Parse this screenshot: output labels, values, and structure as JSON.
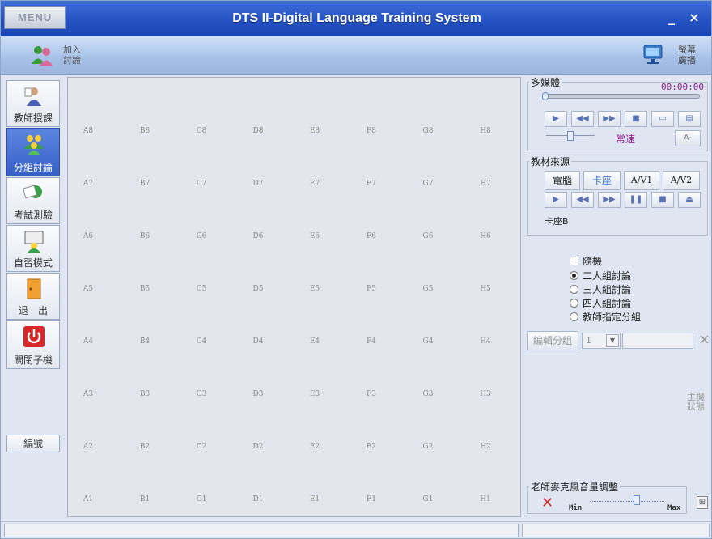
{
  "window": {
    "menu_label": "MENU",
    "title": "DTS II-Digital Language Training System",
    "minimize": "_",
    "close": "×"
  },
  "toolbar": {
    "join_label": "加入\n討論",
    "broadcast_label": "螢幕\n廣播"
  },
  "sidebar": {
    "items": [
      {
        "label": "教師授課",
        "icon": "teacher-icon"
      },
      {
        "label": "分組討論",
        "icon": "group-icon",
        "active": true
      },
      {
        "label": "考試測驗",
        "icon": "exam-icon"
      },
      {
        "label": "自習模式",
        "icon": "study-icon"
      },
      {
        "label": "退　出",
        "icon": "exit-door-icon"
      },
      {
        "label": "關閉子機",
        "icon": "power-icon"
      }
    ],
    "edit_label": "編號"
  },
  "grid": {
    "rows": [
      [
        "A8",
        "B8",
        "C8",
        "D8",
        "E8",
        "F8",
        "G8",
        "H8"
      ],
      [
        "A7",
        "B7",
        "C7",
        "D7",
        "E7",
        "F7",
        "G7",
        "H7"
      ],
      [
        "A6",
        "B6",
        "C6",
        "D6",
        "E6",
        "F6",
        "G6",
        "H6"
      ],
      [
        "A5",
        "B5",
        "C5",
        "D5",
        "E5",
        "F5",
        "G5",
        "H5"
      ],
      [
        "A4",
        "B4",
        "C4",
        "D4",
        "E4",
        "F4",
        "G4",
        "H4"
      ],
      [
        "A3",
        "B3",
        "C3",
        "D3",
        "E3",
        "F3",
        "G3",
        "H3"
      ],
      [
        "A2",
        "B2",
        "C2",
        "D2",
        "E2",
        "F2",
        "G2",
        "H2"
      ],
      [
        "A1",
        "B1",
        "C1",
        "D1",
        "E1",
        "F1",
        "G1",
        "H1"
      ]
    ]
  },
  "multimedia": {
    "legend": "多媒體",
    "time": "00:00:00",
    "speed_label": "常速",
    "font_btn": "A-"
  },
  "source": {
    "legend": "教材來源",
    "buttons": [
      "電腦",
      "卡座",
      "A/V1",
      "A/V2"
    ],
    "active": "卡座",
    "status": "卡座B"
  },
  "grouping": {
    "random_label": "隨機",
    "options": [
      "二人組討論",
      "三人組討論",
      "四人組討論",
      "教師指定分組"
    ],
    "selected": "二人組討論",
    "edit_group_label": "編輯分組",
    "group_value": "1",
    "host_status": "主機\n狀態"
  },
  "mic": {
    "legend": "老師麥克風音量調整",
    "min_label": "Min",
    "max_label": "Max"
  },
  "colors": {
    "title_bar": "#2553c4",
    "active_tab": "#3660c8",
    "accent_text": "#8b1a8b"
  }
}
